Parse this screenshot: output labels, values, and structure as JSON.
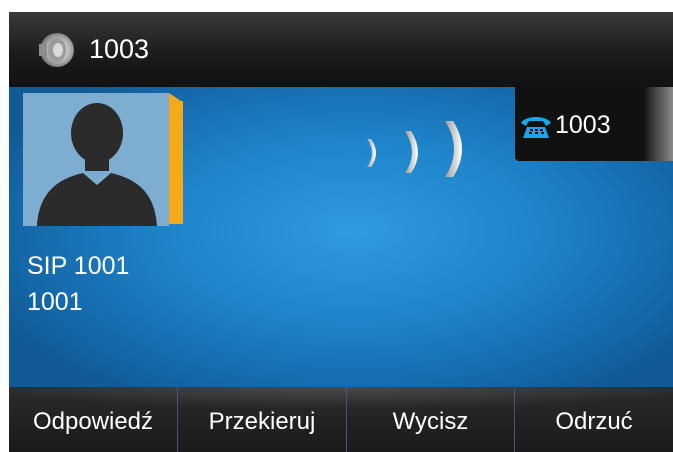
{
  "status_bar": {
    "extension": "1003",
    "icon": "speaker-icon"
  },
  "caller": {
    "name": "SIP 1001",
    "number": "1001",
    "avatar": "person-silhouette-icon"
  },
  "call_state_icon": "ringing-waves-icon",
  "line_key": {
    "label": "1003",
    "icon": "phone-icon",
    "icon_color": "#1aa5e6"
  },
  "softkeys": [
    {
      "label": "Odpowiedź"
    },
    {
      "label": "Przekieruj"
    },
    {
      "label": "Wycisz"
    },
    {
      "label": "Odrzuć"
    }
  ],
  "colors": {
    "background_blue": "#1f85cc",
    "avatar_tab": "#f4a91a",
    "avatar_bg": "#7fb0d6"
  }
}
